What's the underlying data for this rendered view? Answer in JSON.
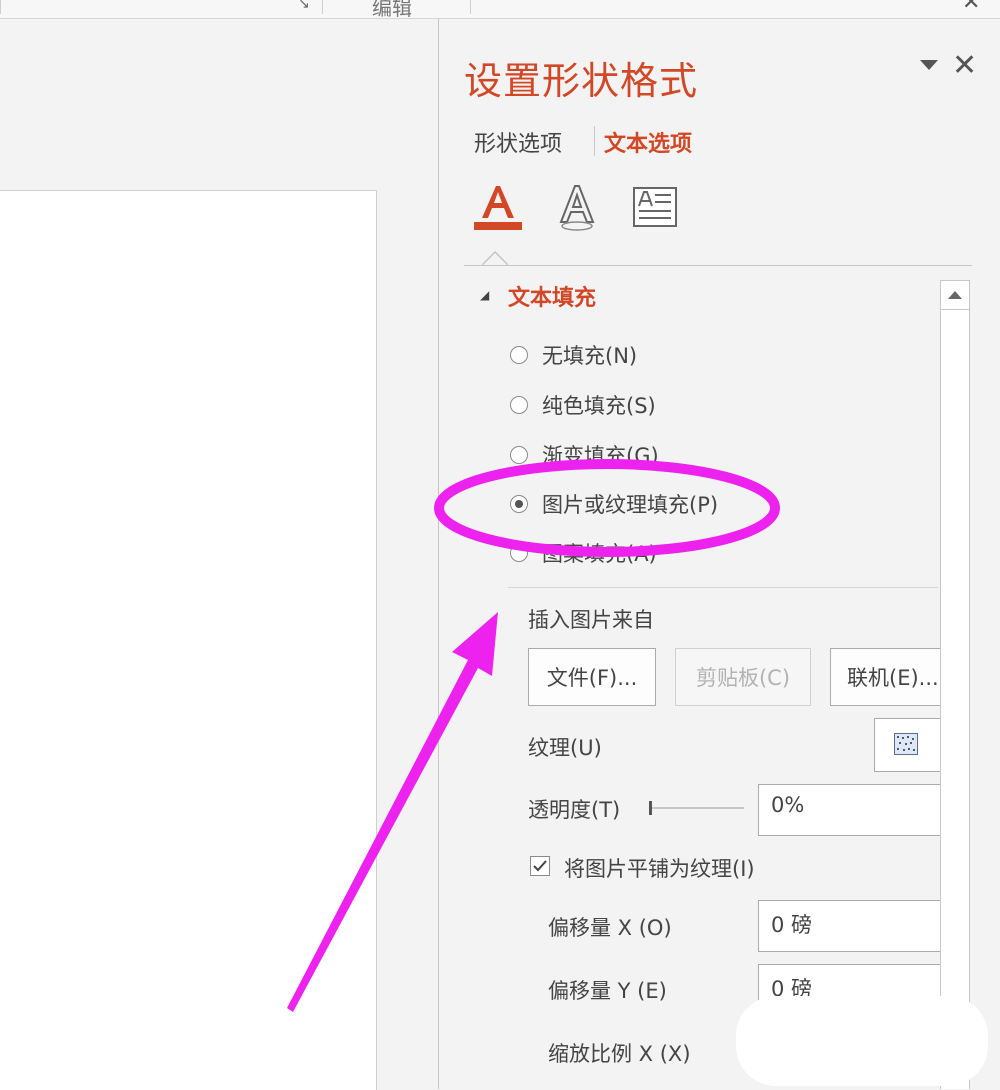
{
  "ribbon": {
    "group_label": "编辑",
    "close_glyph": "✕"
  },
  "pane": {
    "title": "设置形状格式",
    "close_glyph": "✕",
    "tabs": [
      {
        "label": "形状选项",
        "active": false
      },
      {
        "label": "文本选项",
        "active": true
      }
    ],
    "icons": [
      "text-fill-outline-icon",
      "text-effects-icon",
      "textbox-icon"
    ],
    "section_title": "文本填充",
    "fill_options": [
      {
        "label": "无填充(N)",
        "checked": false
      },
      {
        "label": "纯色填充(S)",
        "checked": false
      },
      {
        "label": "渐变填充(G)",
        "checked": false
      },
      {
        "label": "图片或纹理填充(P)",
        "checked": true
      },
      {
        "label": "图案填充(A)",
        "checked": false
      }
    ],
    "insert_from_label": "插入图片来自",
    "buttons": {
      "file": "文件(F)...",
      "clipboard": "剪贴板(C)",
      "online": "联机(E)..."
    },
    "texture_label": "纹理(U)",
    "transparency_label": "透明度(T)",
    "transparency_value": "0%",
    "tile_label": "将图片平铺为纹理(I)",
    "tile_checked": true,
    "offset_x_label": "偏移量 X (O)",
    "offset_x_value": "0 磅",
    "offset_y_label": "偏移量 Y (E)",
    "offset_y_value": "0 磅",
    "scale_x_label": "缩放比例 X (X)"
  },
  "colors": {
    "accent": "#d24726",
    "annotation": "#ee22ee",
    "border": "#ababab"
  }
}
